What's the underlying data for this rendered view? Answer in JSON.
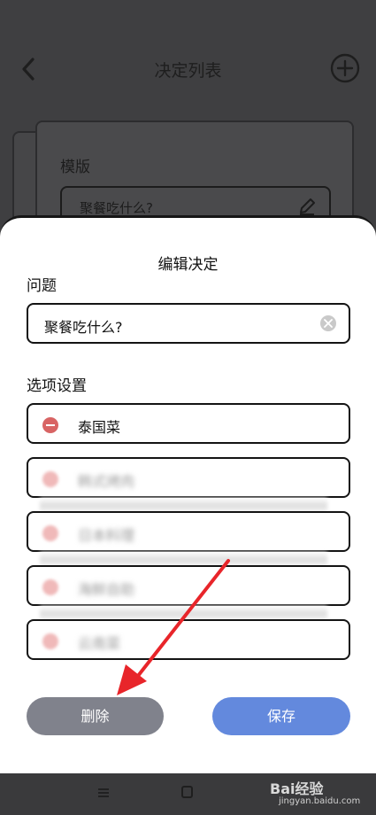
{
  "header": {
    "title": "决定列表",
    "back_icon": "chevron-left-icon",
    "add_icon": "plus-circle-icon"
  },
  "background_card": {
    "label": "模版",
    "field_text": "聚餐吃什么?"
  },
  "sheet": {
    "title": "编辑决定",
    "question_label": "问题",
    "question_value": "聚餐吃什么?",
    "options_label": "选项设置",
    "options": [
      {
        "text": "泰国菜"
      },
      {
        "text": "韩式烤肉"
      },
      {
        "text": "日本料理"
      },
      {
        "text": "海鲜自助"
      },
      {
        "text": "云南菜"
      }
    ],
    "delete_label": "删除",
    "save_label": "保存"
  },
  "colors": {
    "delete": "#80828c",
    "save": "#6389dd",
    "minus": "#d86464",
    "arrow": "#e8252a"
  },
  "watermark": {
    "brand": "Bai经验",
    "url": "jingyan.baidu.com"
  }
}
